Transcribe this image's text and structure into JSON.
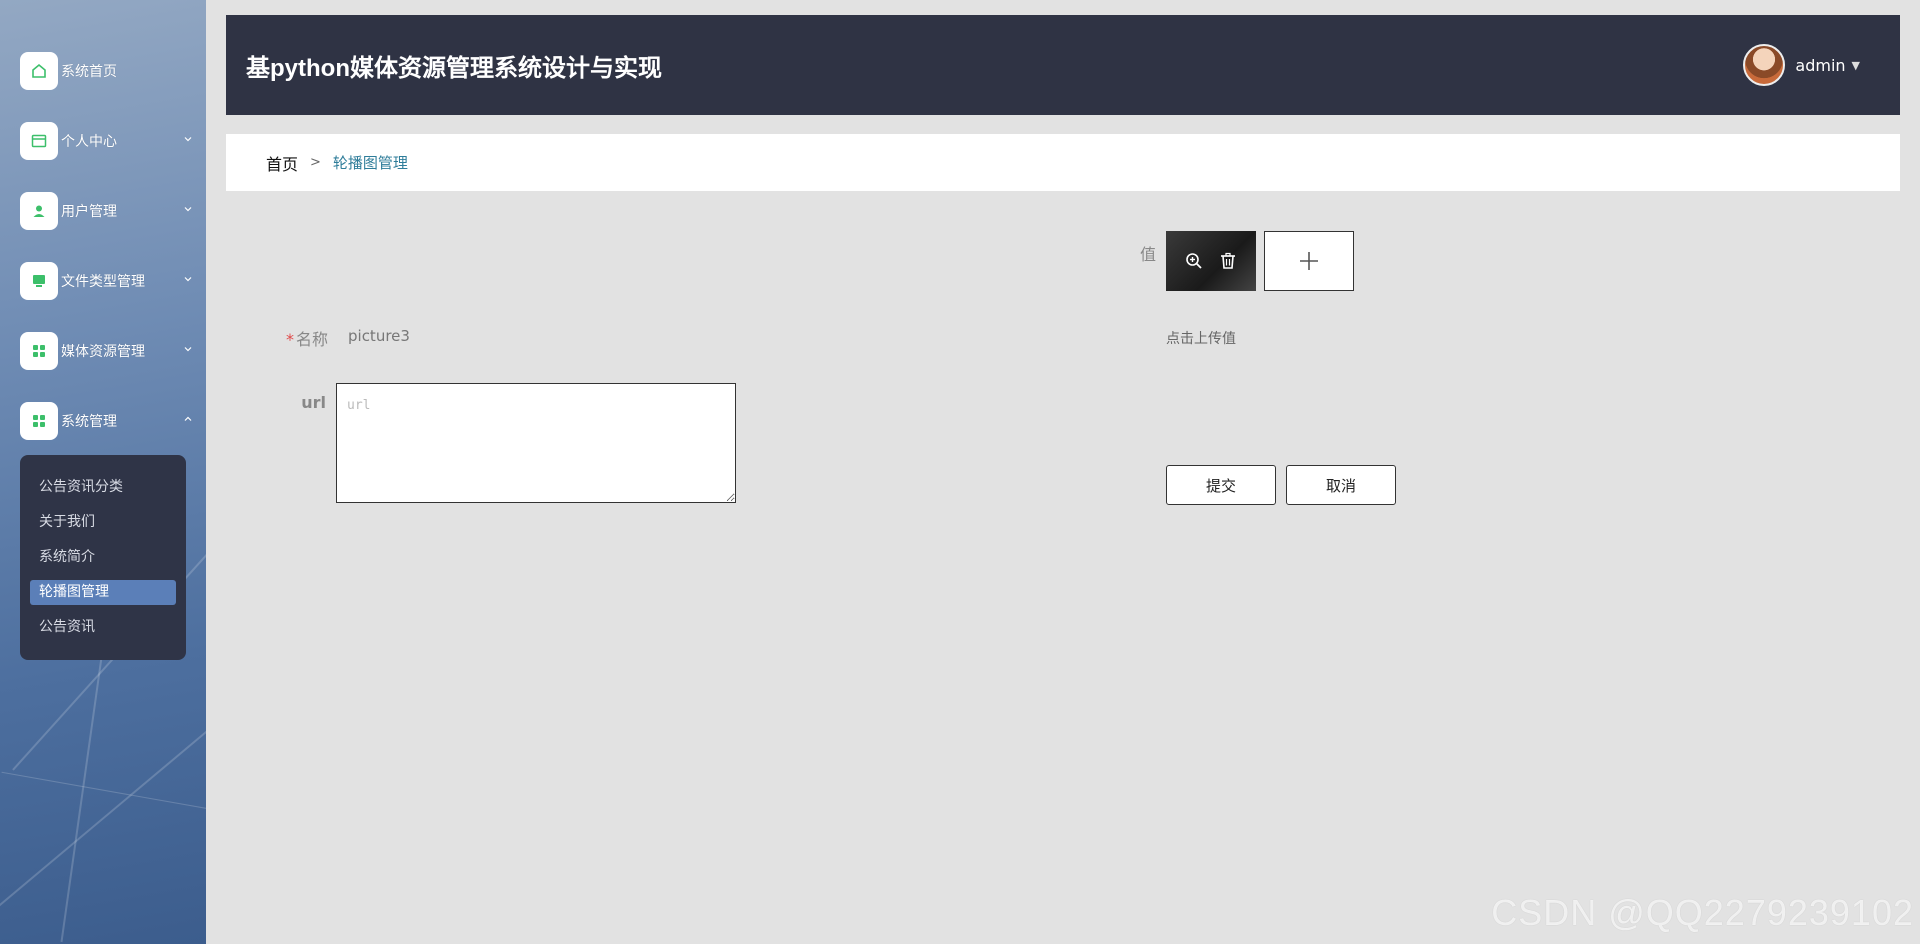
{
  "sidebar": {
    "items": [
      {
        "label": "系统首页",
        "icon": "home-icon"
      },
      {
        "label": "个人中心",
        "icon": "profile-card-icon"
      },
      {
        "label": "用户管理",
        "icon": "user-icon"
      },
      {
        "label": "文件类型管理",
        "icon": "monitor-icon"
      },
      {
        "label": "媒体资源管理",
        "icon": "grid-icon"
      },
      {
        "label": "系统管理",
        "icon": "grid-icon"
      }
    ],
    "submenu": [
      {
        "label": "公告资讯分类"
      },
      {
        "label": "关于我们"
      },
      {
        "label": "系统简介"
      },
      {
        "label": "轮播图管理",
        "active": true
      },
      {
        "label": "公告资讯"
      }
    ]
  },
  "header": {
    "title": "基python媒体资源管理系统设计与实现",
    "username": "admin"
  },
  "breadcrumb": {
    "home": "首页",
    "separator": ">",
    "current": "轮播图管理"
  },
  "form": {
    "name_label": "名称",
    "name_value": "picture3",
    "url_label": "url",
    "url_placeholder": "url",
    "value_label": "值",
    "upload_hint": "点击上传值",
    "submit_label": "提交",
    "cancel_label": "取消"
  },
  "watermark": "CSDN @QQ2279239102",
  "colors": {
    "header_bg": "#2f3344",
    "submenu_bg": "#2f3447",
    "active_item": "#5b7fb8",
    "icon_green": "#3cbf6a",
    "breadcrumb_current": "#2f7d9a"
  }
}
